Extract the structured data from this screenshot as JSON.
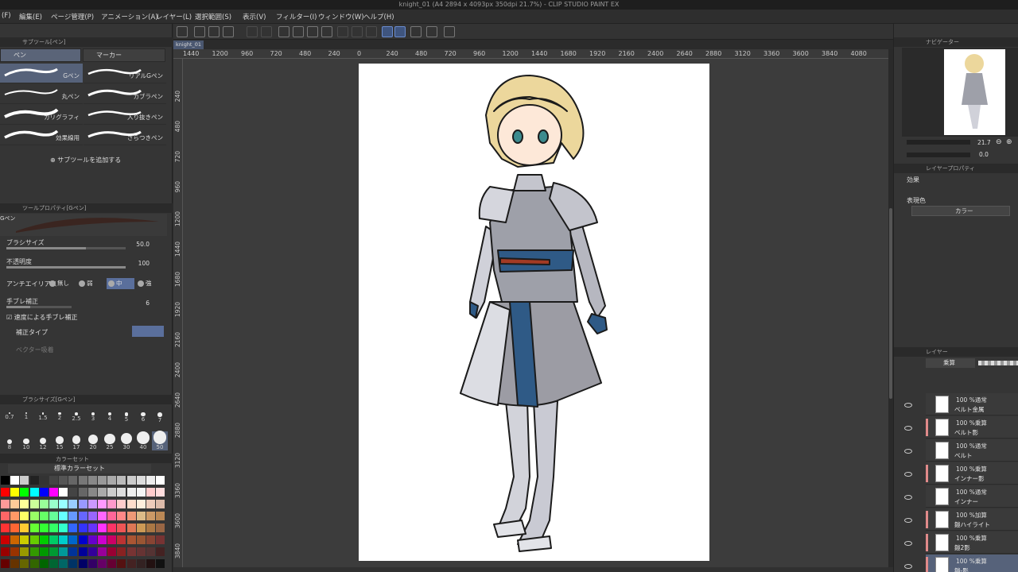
{
  "title": "knight_01 (A4 2894 x 4093px 350dpi 21.7%) - CLIP STUDIO PAINT EX",
  "menu": [
    "(F)",
    "編集(E)",
    "ページ管理(P)",
    "アニメーション(A)",
    "レイヤー(L)",
    "選択範囲(S)",
    "表示(V)",
    "フィルター(I)",
    "ウィンドウ(W)",
    "ヘルプ(H)"
  ],
  "subtool_panel": {
    "header": "サブツール[ペン]",
    "tabs": [
      "ペン",
      "マーカー"
    ],
    "items": [
      "Gペン",
      "リアルGペン",
      "丸ペン",
      "カブラペン",
      "カリグラフィ",
      "入り抜きペン",
      "効果線用",
      "ざらつきペン"
    ],
    "add_label": "サブツールを追加する"
  },
  "tool_property": {
    "header": "ツールプロパティ[Gペン]",
    "preview_label": "Gペン",
    "brush_size_label": "ブラシサイズ",
    "brush_size_value": "50.0",
    "opacity_label": "不透明度",
    "opacity_value": "100",
    "antialias_label": "アンチエイリアス",
    "antialias_options": [
      "無し",
      "弱",
      "中",
      "強"
    ],
    "stabilization_label": "手ブレ補正",
    "stabilization_value": "6",
    "speed_label": "速度による手ブレ補正",
    "correction_label": "補正タイプ",
    "vector_label": "ベクター吸着"
  },
  "brush_size_panel": {
    "header": "ブラシサイズ[Gペン]",
    "sizes": [
      "0.7",
      "1",
      "1.5",
      "2",
      "2.5",
      "3",
      "4",
      "5",
      "6",
      "7",
      "8",
      "10",
      "12",
      "15",
      "17",
      "20",
      "25",
      "30",
      "40",
      "50"
    ]
  },
  "color_set": {
    "tab": "カラーセット",
    "name": "標準カラーセット"
  },
  "canvas": {
    "tab": "knight_01",
    "ruler_top": [
      "1440",
      "1200",
      "960",
      "720",
      "480",
      "240",
      "0",
      "240",
      "480",
      "720",
      "960",
      "1200",
      "1440",
      "1680",
      "1920",
      "2160",
      "2400",
      "2640",
      "2880",
      "3120",
      "3360",
      "3600",
      "3840",
      "4080"
    ],
    "ruler_left": [
      "240",
      "480",
      "720",
      "960",
      "1200",
      "1440",
      "1680",
      "1920",
      "2160",
      "2400",
      "2640",
      "2880",
      "3120",
      "3360",
      "3600",
      "3840"
    ]
  },
  "navigator": {
    "header": "ナビゲーター",
    "zoom": "21.7",
    "angle": "0.0"
  },
  "layer_property": {
    "header": "レイヤープロパティ",
    "effect_label": "効果",
    "expression_label": "表現色",
    "expression_value": "カラー"
  },
  "layers": {
    "tabs": [
      "レイヤー"
    ],
    "blend_mode": "乗算",
    "items": [
      {
        "mode": "100 %通常",
        "name": "ベルト金属"
      },
      {
        "mode": "100 %乗算",
        "name": "ベルト影"
      },
      {
        "mode": "100 %通常",
        "name": "ベルト"
      },
      {
        "mode": "100 %乗算",
        "name": "インナー影"
      },
      {
        "mode": "100 %通常",
        "name": "インナー"
      },
      {
        "mode": "100 %加算",
        "name": "鎧ハイライト"
      },
      {
        "mode": "100 %乗算",
        "name": "鎧2影"
      },
      {
        "mode": "100 %乗算",
        "name": "鎧-影"
      }
    ]
  },
  "status": {
    "zoom": "21.7",
    "angle": "0.0"
  },
  "colors": {
    "accent": "#5a6478",
    "selected": "#56627a",
    "clip": "#e08a8a"
  }
}
